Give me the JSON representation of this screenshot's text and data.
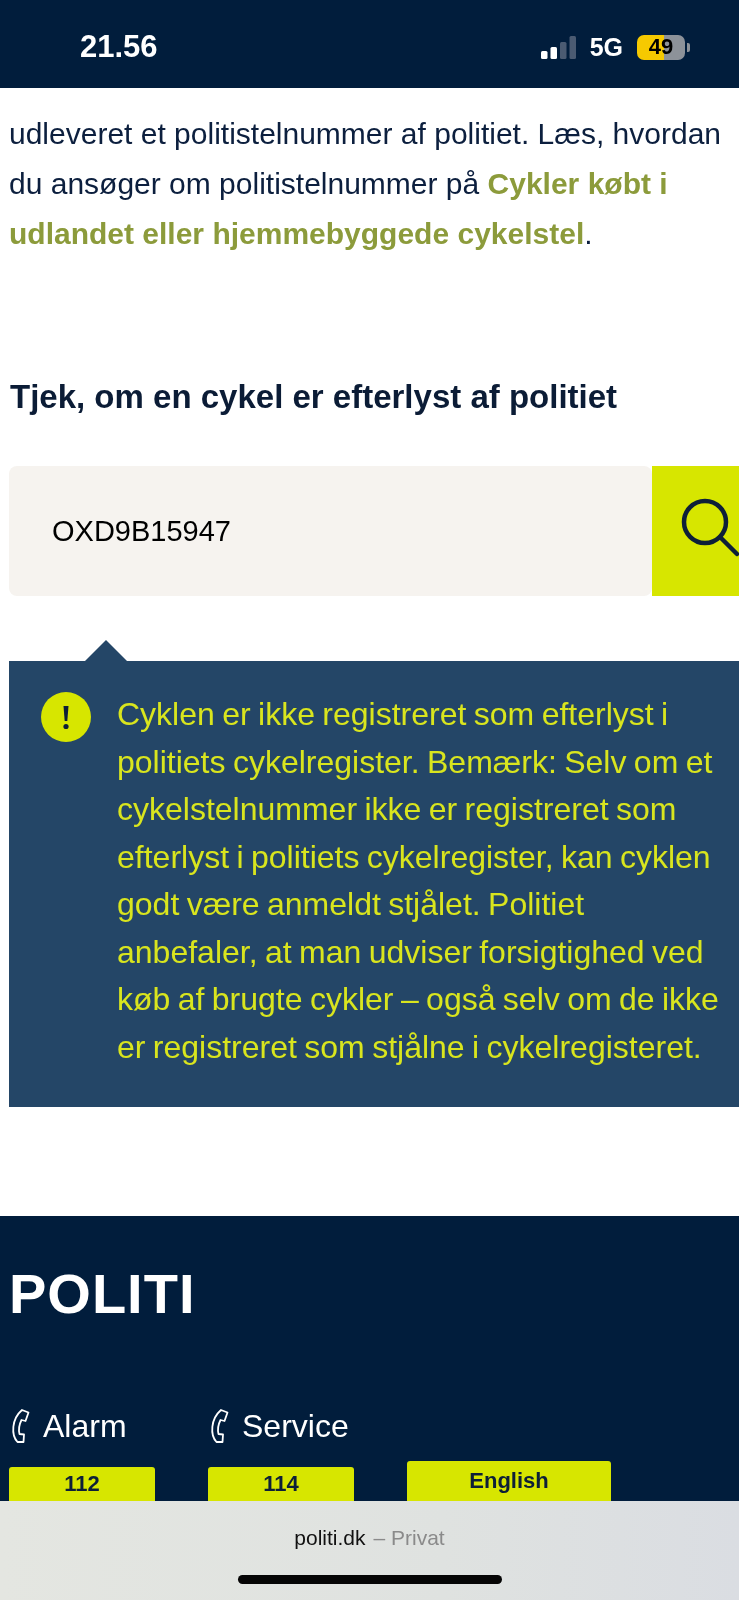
{
  "status_bar": {
    "time": "21.56",
    "network": "5G",
    "battery": "49"
  },
  "intro": {
    "text": "udleveret et politistelnummer af politiet. Læs, hvordan du ansøger om politistelnummer på",
    "link_parts": [
      "Cykler købt i",
      "udlandet eller hjemmebyggede cykelstel"
    ],
    "end": "."
  },
  "check": {
    "heading": "Tjek, om en cykel er efterlyst af politiet",
    "search": {
      "value": "OXD9B15947"
    },
    "result": {
      "text": "Cyklen er ikke registreret som efterlyst i politiets cykelregister. Bemærk: Selv om et cykelstelnummer ikke er registreret som efterlyst i politiets cykelregister, kan cyklen godt være anmeldt stjålet. Politiet anbefaler, at man udviser forsigtighed ved køb af brugte cykler – også selv om de ikke er registreret som stjålne i cykelregisteret."
    }
  },
  "footer": {
    "logo": "POLITI",
    "phones": [
      {
        "label": "Alarm",
        "number": "112"
      },
      {
        "label": "Service",
        "number": "114"
      }
    ],
    "language_button": "English"
  },
  "browser_bar": {
    "domain": "politi.dk",
    "mode": "– Privat"
  }
}
